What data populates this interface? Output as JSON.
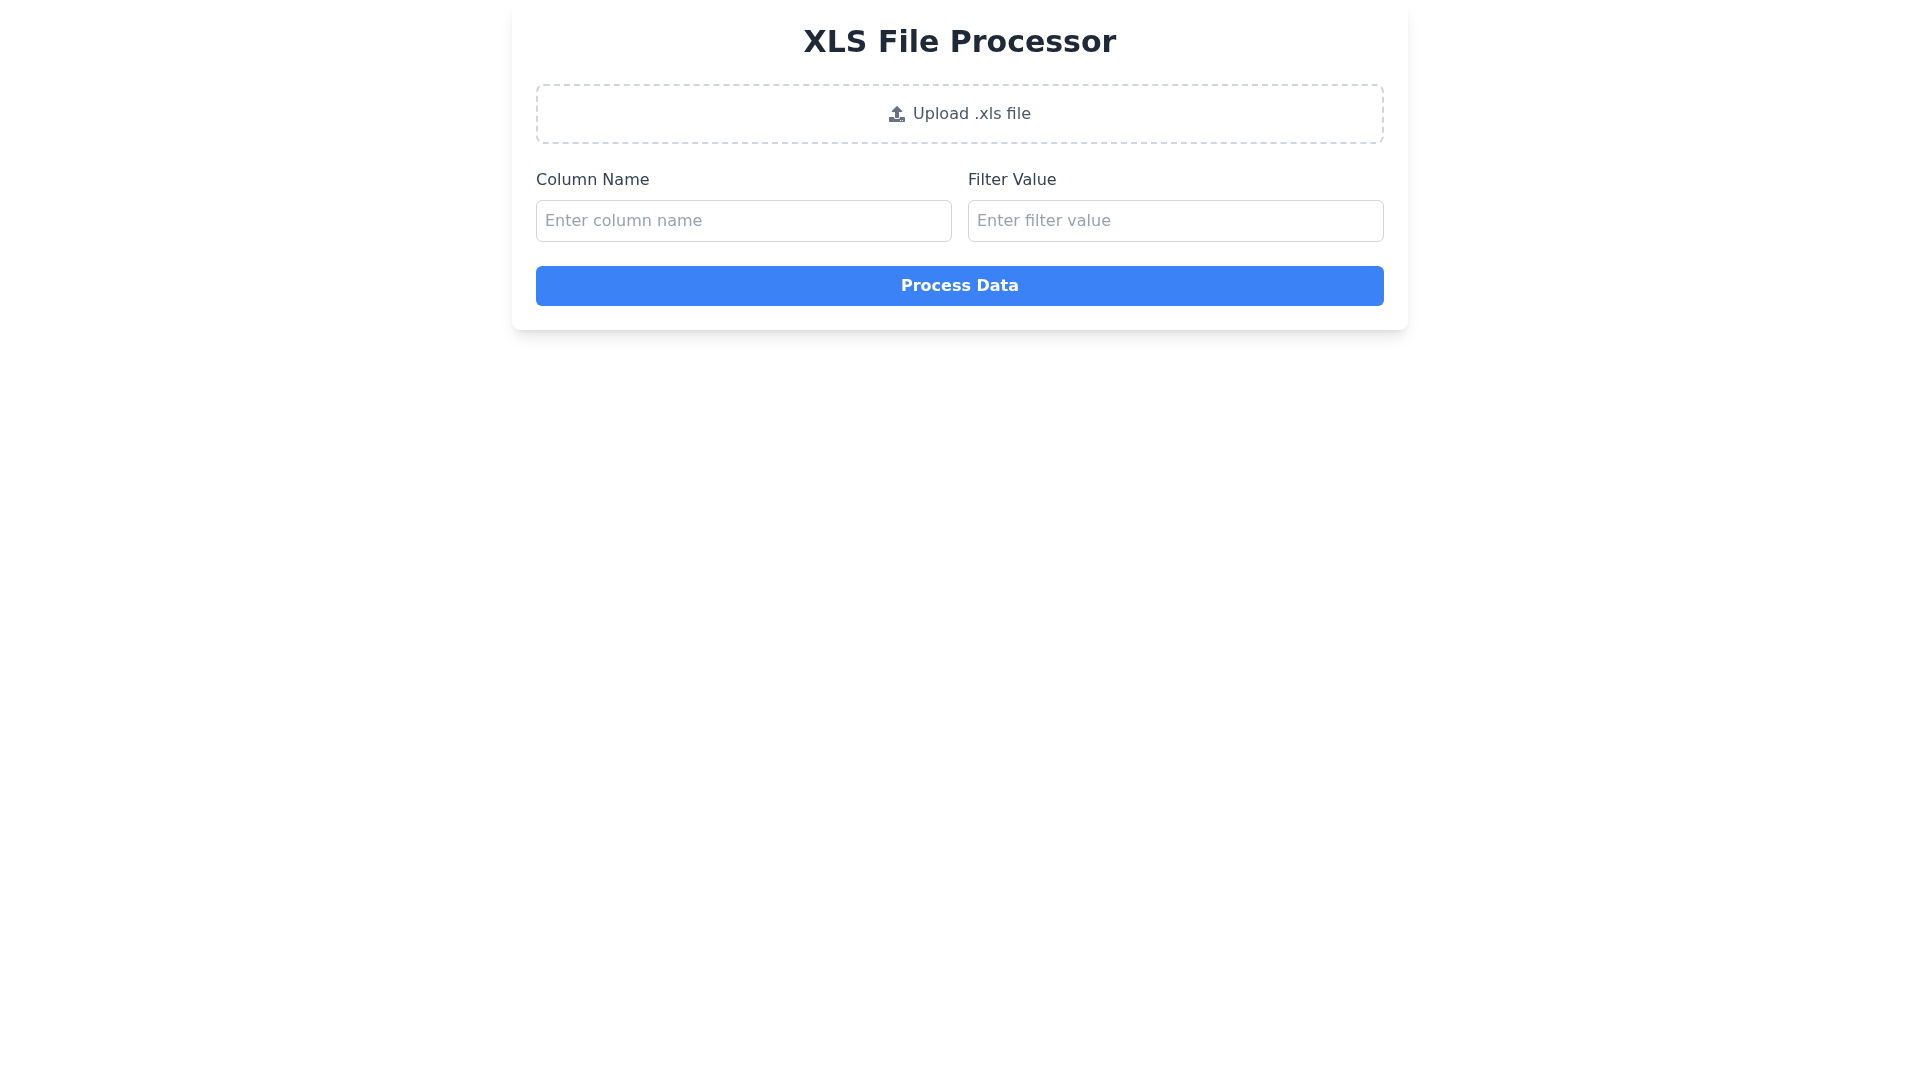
{
  "title": "XLS File Processor",
  "upload": {
    "label": "Upload .xls file"
  },
  "fields": [
    {
      "label": "Column Name",
      "placeholder": "Enter column name"
    },
    {
      "label": "Filter Value",
      "placeholder": "Enter filter value"
    }
  ],
  "button": {
    "label": "Process Data"
  }
}
